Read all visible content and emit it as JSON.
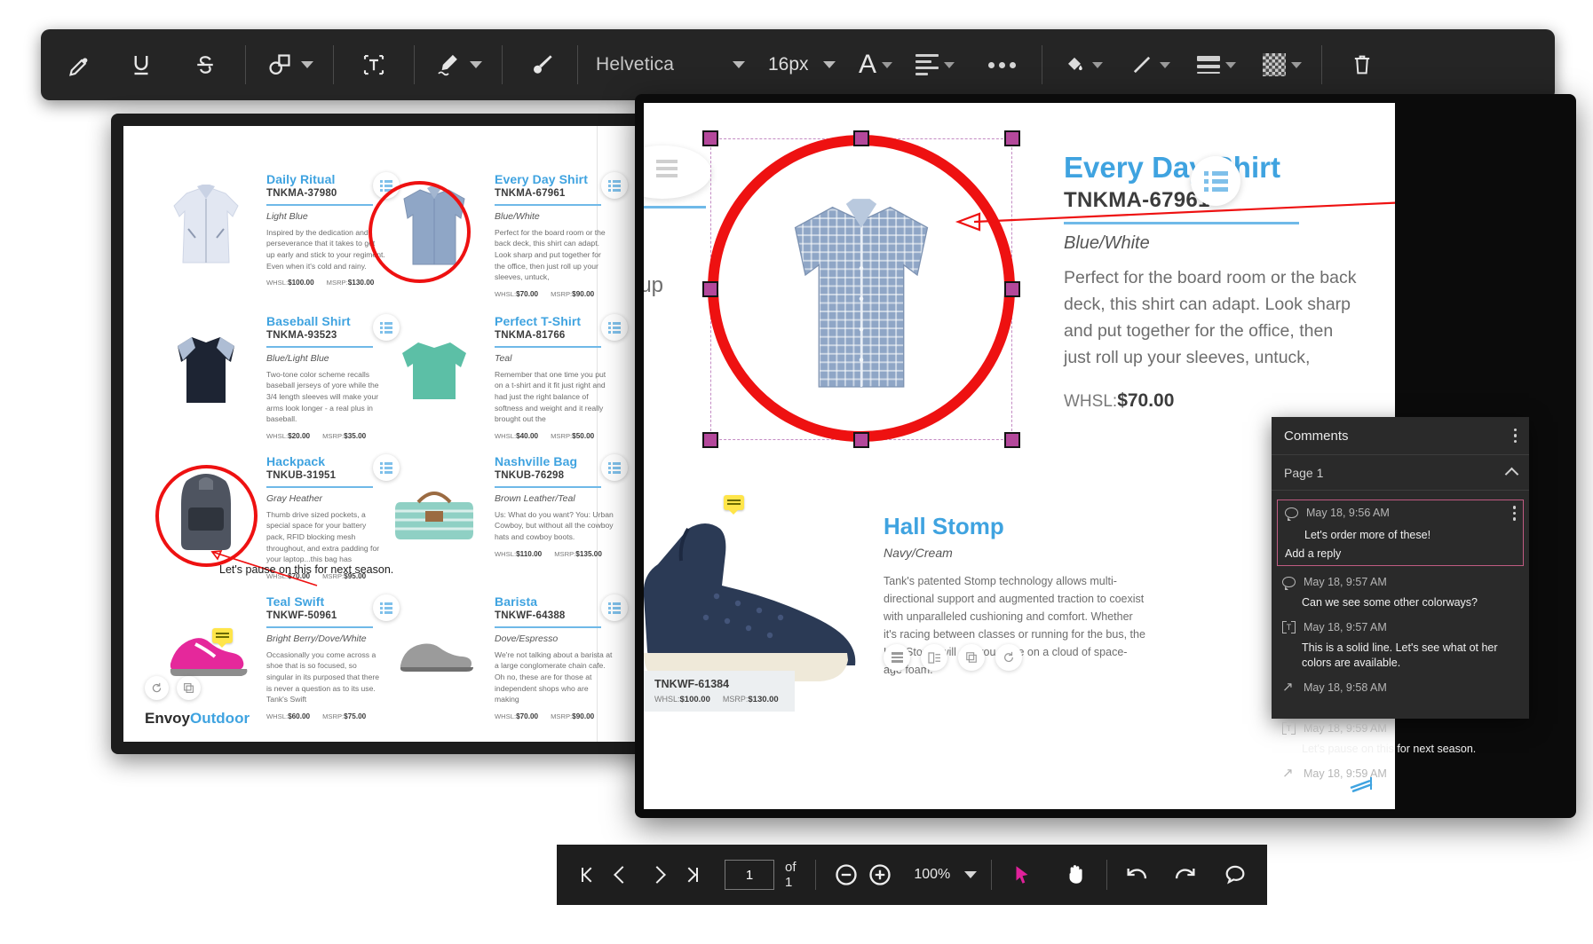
{
  "toolbar": {
    "tools": [
      {
        "name": "highlighter-tool",
        "label": "Highlight"
      },
      {
        "name": "underline-tool",
        "label": "U"
      },
      {
        "name": "strikethrough-tool",
        "label": "S"
      },
      {
        "name": "shape-tool",
        "label": "Shape"
      },
      {
        "name": "text-box-tool",
        "label": "T"
      },
      {
        "name": "signature-tool",
        "label": "Sign"
      },
      {
        "name": "brush-tool",
        "label": "Brush"
      }
    ],
    "font_family": "Helvetica",
    "font_size": "16px",
    "text_color_label": "A",
    "more_options_label": "•••",
    "fill_color_label": "Fill",
    "line_style_label": "Line",
    "line_weight_label": "Weight",
    "opacity_label": "Opacity",
    "delete_label": "Delete"
  },
  "catalog": {
    "brand_a": "Envoy",
    "brand_b": "Outdoor",
    "annotation_note": "Let's pause on this for next season.",
    "products": [
      {
        "title": "Daily Ritual",
        "sku": "TNKMA-37980",
        "color": "Light Blue",
        "desc": "Inspired by the dedication and perseverance that it takes to get up early and stick to your regiment. Even when it's cold and rainy.",
        "whsl_label": "WHSL:",
        "whsl": "$100.00",
        "msrp_label": "MSRP:",
        "msrp": "$130.00"
      },
      {
        "title": "Every Day Shirt",
        "sku": "TNKMA-67961",
        "color": "Blue/White",
        "desc": "Perfect for the board room or the back deck, this shirt can adapt.  Look sharp and put together for the office, then just roll up your sleeves, untuck,",
        "whsl_label": "WHSL:",
        "whsl": "$70.00",
        "msrp_label": "MSRP:",
        "msrp": "$90.00"
      },
      {
        "title": "Baseball Shirt",
        "sku": "TNKMA-93523",
        "color": "Blue/Light Blue",
        "desc": "Two-tone color scheme recalls baseball jerseys of yore while the 3/4 length sleeves will make your arms look longer - a real plus in baseball.",
        "whsl_label": "WHSL:",
        "whsl": "$20.00",
        "msrp_label": "MSRP:",
        "msrp": "$35.00"
      },
      {
        "title": "Perfect T-Shirt",
        "sku": "TNKMA-81766",
        "color": "Teal",
        "desc": "Remember that one time you put on a t-shirt and it fit just right and had just the right balance of softness and weight and it really brought out the",
        "whsl_label": "WHSL:",
        "whsl": "$40.00",
        "msrp_label": "MSRP:",
        "msrp": "$50.00"
      },
      {
        "title": "Hackpack",
        "sku": "TNKUB-31951",
        "color": "Gray Heather",
        "desc": "Thumb drive sized pockets, a special space for your battery pack, RFID blocking mesh throughout, and extra padding for your laptop...this bag has",
        "whsl_label": "WHSL:",
        "whsl": "$70.00",
        "msrp_label": "MSRP:",
        "msrp": "$95.00"
      },
      {
        "title": "Nashville Bag",
        "sku": "TNKUB-76298",
        "color": "Brown Leather/Teal",
        "desc": "Us: What do you want? You: Urban Cowboy, but without all the cowboy hats and cowboy boots.",
        "whsl_label": "WHSL:",
        "whsl": "$110.00",
        "msrp_label": "MSRP:",
        "msrp": "$135.00"
      },
      {
        "title": "Teal Swift",
        "sku": "TNKWF-50961",
        "color": "Bright Berry/Dove/White",
        "desc": "Occasionally you come across a shoe that is so focused, so singular in its purposed that there is never a question as to its use.  Tank's Swift",
        "whsl_label": "WHSL:",
        "whsl": "$60.00",
        "msrp_label": "MSRP:",
        "msrp": "$75.00"
      },
      {
        "title": "Barista",
        "sku": "TNKWF-64388",
        "color": "Dove/Espresso",
        "desc": "We're not talking about a barista at a large conglomerate chain cafe.  Oh no, these are for those at independent shops who are making",
        "whsl_label": "WHSL:",
        "whsl": "$70.00",
        "msrp_label": "MSRP:",
        "msrp": "$90.00"
      }
    ]
  },
  "detail": {
    "partial_note_line1": "This",
    "partial_note_line2": "what",
    "partial_text_1": "t up",
    "partial_price": "0",
    "product": {
      "title": "Every Day Shirt",
      "sku": "TNKMA-67961",
      "color": "Blue/White",
      "desc": "Perfect for the board room or the back deck, this shirt can adapt.  Look sharp and put together for the office, then just roll up your sleeves, untuck,",
      "whsl_label": "WHSL:",
      "whsl": "$70.00"
    },
    "hall_stomp": {
      "title": "Hall Stomp",
      "color": "Navy/Cream",
      "desc": "Tank's patented Stomp technology allows multi-directional support and augmented traction to coexist with unparalleled cushioning and comfort. Whether it's racing between classes or running for the bus, the Hall Stomp will get you there on a cloud of space-age foam.",
      "sku": "TNKWF-61384",
      "whsl_label": "WHSL:",
      "whsl": "$100.00",
      "msrp_label": "MSRP:",
      "msrp": "$130.00"
    }
  },
  "comments": {
    "title": "Comments",
    "page_group": "Page 1",
    "reply_placeholder": "Add a reply",
    "items": [
      {
        "icon": "comment-bubble-icon",
        "time": "May 18, 9:56 AM",
        "body": "Let's order more of these!",
        "selected": true
      },
      {
        "icon": "comment-bubble-icon",
        "time": "May 18, 9:57 AM",
        "body": "Can we see some other colorways?",
        "selected": false
      },
      {
        "icon": "text-annotation-icon",
        "time": "May 18, 9:57 AM",
        "body": "This is a solid line. Let's see what ot her colors are available.",
        "selected": false
      },
      {
        "icon": "arrow-annotation-icon",
        "time": "May 18, 9:58 AM",
        "body": "",
        "selected": false
      },
      {
        "icon": "text-annotation-icon",
        "time": "May 18, 9:59 AM",
        "body": "Let's pause on this for next season.",
        "selected": false
      },
      {
        "icon": "arrow-annotation-icon",
        "time": "May 18, 9:59 AM",
        "body": "",
        "selected": false
      }
    ]
  },
  "bottombar": {
    "first_page_label": "First page",
    "prev_page_label": "Previous page",
    "next_page_label": "Next page",
    "last_page_label": "Last page",
    "page_value": "1",
    "page_total": "of 1",
    "zoom_out_label": "−",
    "zoom_in_label": "+",
    "zoom_level": "100%",
    "select_tool_label": "Select",
    "pan_tool_label": "Pan",
    "undo_label": "Undo",
    "redo_label": "Redo",
    "comment_label": "Comment"
  },
  "colors": {
    "accent_blue": "#3fa3e0",
    "annotation_red": "#ee1111",
    "handle_magenta": "#b4489b",
    "selected_comment_border": "#c05b82",
    "toolbar_bg": "#252525"
  }
}
